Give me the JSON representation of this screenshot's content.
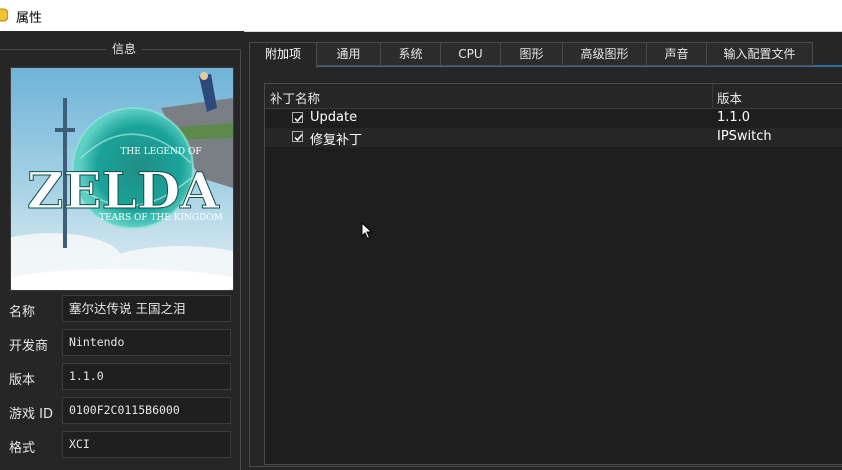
{
  "window": {
    "title": "属性"
  },
  "info": {
    "legend": "信息",
    "cover_title_main": "ZELDA",
    "cover_title_top": "THE LEGEND OF",
    "cover_title_bottom": "TEARS OF THE KINGDOM",
    "fields": [
      {
        "label": "名称",
        "value": "塞尔达传说 王国之泪"
      },
      {
        "label": "开发商",
        "value": "Nintendo"
      },
      {
        "label": "版本",
        "value": "1.1.0"
      },
      {
        "label": "游戏 ID",
        "value": "0100F2C0115B6000"
      },
      {
        "label": "格式",
        "value": "XCI"
      }
    ]
  },
  "tabs": [
    "附加项",
    "通用",
    "系统",
    "CPU",
    "图形",
    "高级图形",
    "声音",
    "输入配置文件"
  ],
  "active_tab": "附加项",
  "addons": {
    "columns": {
      "name": "补丁名称",
      "version": "版本"
    },
    "rows": [
      {
        "name": "Update",
        "version": "1.1.0",
        "checked": true
      },
      {
        "name": "修复补丁",
        "version": "IPSwitch",
        "checked": true
      }
    ]
  },
  "colors": {
    "background": "#262626",
    "accent": "#2f6f9e",
    "titlebar": "#ffffff"
  }
}
